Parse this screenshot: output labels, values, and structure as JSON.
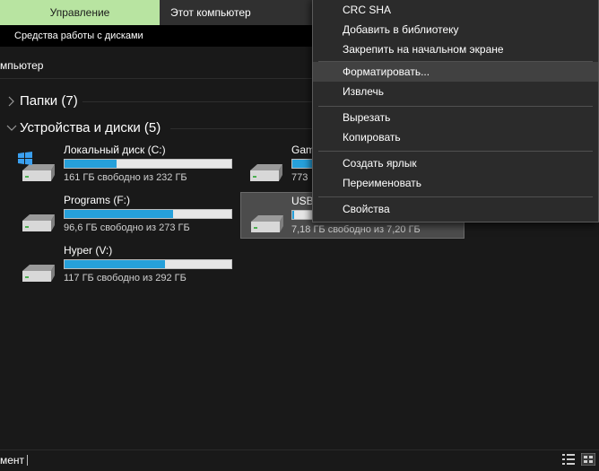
{
  "ribbon": {
    "manage_tab": "Управление",
    "computer_tab": "Этот компьютер",
    "drive_tools": "Средства работы с дисками"
  },
  "address": {
    "text": "мпьютер"
  },
  "groups": {
    "folders": "Папки (7)",
    "devices": "Устройства и диски (5)"
  },
  "drives": [
    {
      "name": "Локальный диск (C:)",
      "free": "161 ГБ свободно из 232 ГБ",
      "used_fraction": 0.31
    },
    {
      "name": "Gam",
      "free": "773",
      "used_fraction": 0.2
    },
    {
      "name": "Programs (F:)",
      "free": "96,6 ГБ свободно из 273 ГБ",
      "used_fraction": 0.65
    },
    {
      "name": "USB",
      "free": "7,18 ГБ свободно из 7,20 ГБ",
      "used_fraction": 0.01
    },
    {
      "name": "Hyper (V:)",
      "free": "117 ГБ свободно из 292 ГБ",
      "used_fraction": 0.6
    }
  ],
  "context_menu": {
    "items": [
      "CRC SHA",
      "Добавить в библиотеку",
      "Закрепить на начальном экране",
      "Форматировать...",
      "Извлечь",
      "Вырезать",
      "Копировать",
      "Создать ярлык",
      "Переименовать",
      "Свойства"
    ]
  },
  "status": {
    "text": "мент"
  },
  "colors": {
    "manage_tab_bg": "#b8e4a1",
    "capacity_bar": "#26a0da",
    "window_bg": "#191919",
    "menu_bg": "#2b2b2b"
  },
  "icons": [
    "chevron-right-icon",
    "chevron-down-icon",
    "windows-logo-icon",
    "drive-icon",
    "details-view-icon",
    "large-icons-view-icon"
  ]
}
